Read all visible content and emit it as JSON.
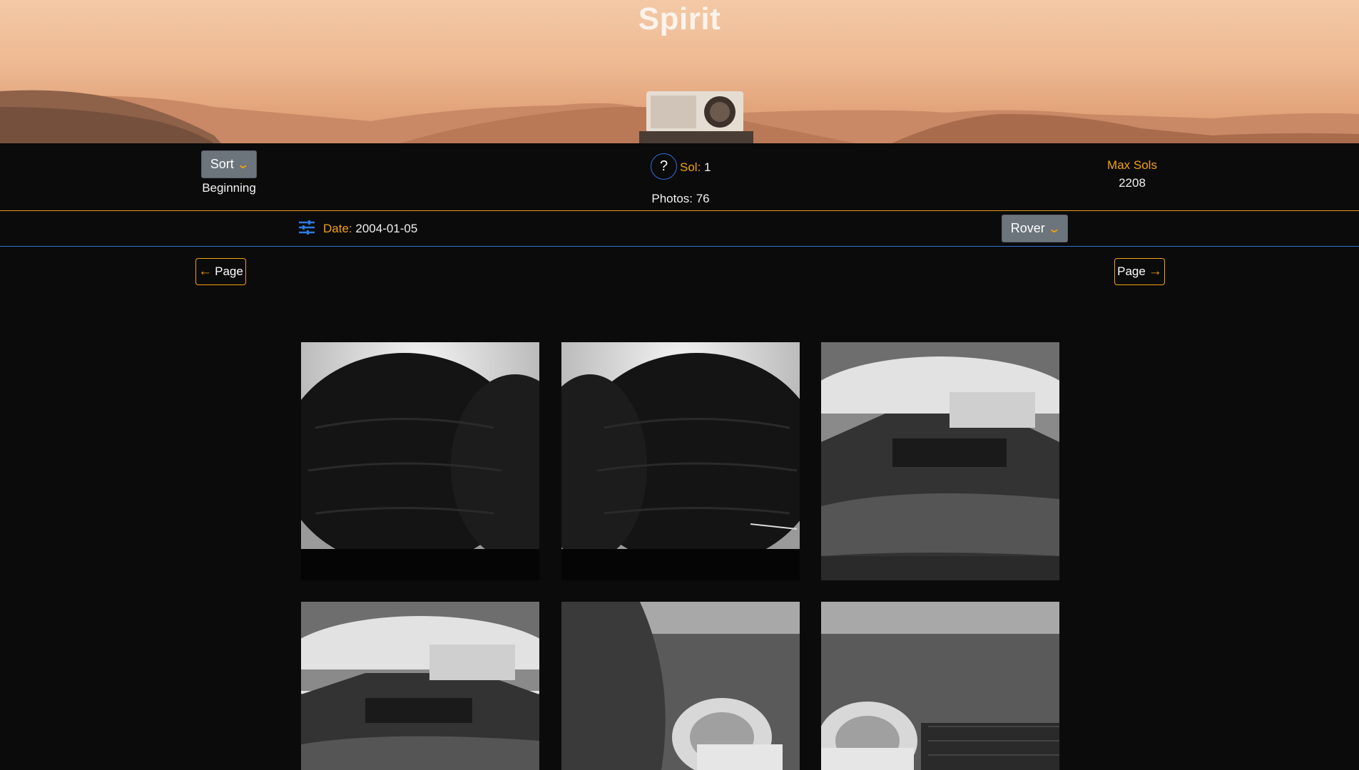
{
  "header": {
    "title": "Spirit"
  },
  "info_bar": {
    "sort_label": "Sort",
    "sort_value": "Beginning",
    "help_label": "?",
    "sol_label": "Sol:",
    "sol_value": "1",
    "photos_text": "Photos: 76",
    "max_sols_label": "Max Sols",
    "max_sols_value": "2208"
  },
  "filter_bar": {
    "filter_icon": "sliders-icon",
    "date_label": "Date:",
    "date_value": "2004-01-05",
    "rover_label": "Rover"
  },
  "pager": {
    "prev_label": "Page",
    "next_label": "Page",
    "prev_icon": "arrow-left-icon",
    "next_icon": "arrow-right-icon"
  },
  "colors": {
    "accent_orange": "#f2a10f",
    "accent_blue": "#2f6fd6",
    "background": "#0b0b0b",
    "button_gray": "#6c747c"
  }
}
